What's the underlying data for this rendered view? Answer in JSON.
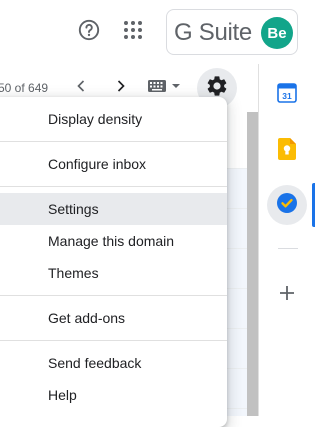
{
  "header": {
    "brand": "G Suite",
    "avatar_initials": "Be",
    "avatar_color": "#12a58a",
    "help_icon": "help-circle-icon",
    "apps_icon": "apps-grid-icon"
  },
  "toolbar": {
    "pagination_text": "50 of 649",
    "prev_icon": "chevron-left-icon",
    "next_icon": "chevron-right-icon",
    "input_tools_icon": "keyboard-icon",
    "settings_icon": "gear-icon"
  },
  "settings_menu": {
    "items": [
      {
        "label": "Display density"
      },
      {
        "label": "Configure inbox"
      },
      {
        "label": "Settings",
        "highlighted": true
      },
      {
        "label": "Manage this domain"
      },
      {
        "label": "Themes"
      },
      {
        "label": "Get add-ons"
      },
      {
        "label": "Send feedback"
      },
      {
        "label": "Help"
      }
    ]
  },
  "side_panel": {
    "apps": [
      {
        "name": "calendar-icon",
        "text": "31",
        "color": "#1a73e8"
      },
      {
        "name": "keep-icon",
        "color": "#fbbc04"
      },
      {
        "name": "tasks-icon",
        "color": "#1a73e8",
        "active": true
      },
      {
        "name": "add-icon"
      }
    ]
  },
  "accent_color": "#1a73e8"
}
